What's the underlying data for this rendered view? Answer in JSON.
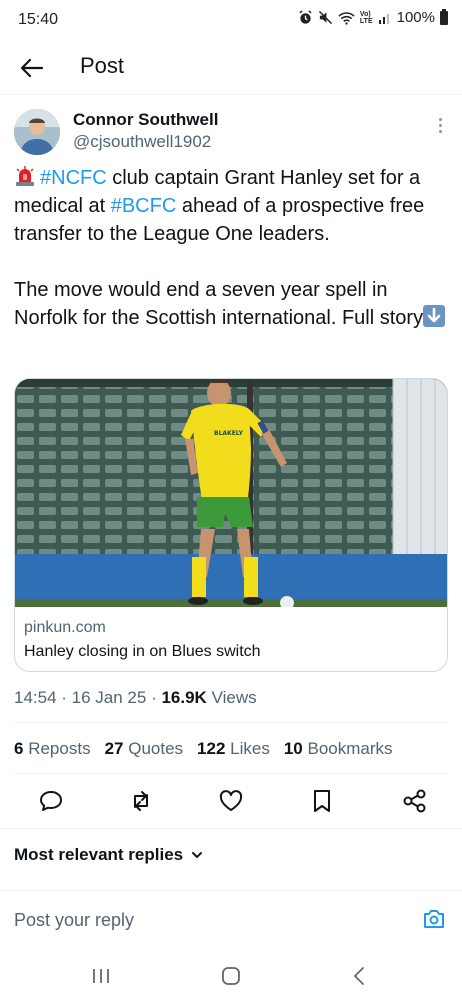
{
  "status_bar": {
    "time": "15:40",
    "battery": "100%",
    "net_label_top": "Vo)",
    "net_label_bottom": "LTE"
  },
  "header": {
    "title": "Post",
    "back_icon": "arrow-left-icon"
  },
  "author": {
    "name": "Connor Southwell",
    "handle": "@cjsouthwell1902"
  },
  "tweet": {
    "p1_a": "club captain Grant Hanley set for a medical at",
    "p1_b": "ahead of a prospective free transfer to the League One leaders.",
    "hashtag1": "#NCFC",
    "hashtag2": "#BCFC",
    "p2": "The move would end a seven year spell in Norfolk for the Scottish international. Full story",
    "link_color": "#1d9bf0"
  },
  "card": {
    "domain": "pinkun.com",
    "title": "Hanley closing in on Blues switch",
    "shirt_sponsor": "BLAKELY"
  },
  "meta": {
    "time": "14:54",
    "date": "16 Jan 25",
    "views_count": "16.9K",
    "views_label": "Views"
  },
  "stats": {
    "reposts_count": "6",
    "reposts_label": "Reposts",
    "quotes_count": "27",
    "quotes_label": "Quotes",
    "likes_count": "122",
    "likes_label": "Likes",
    "bookmarks_count": "10",
    "bookmarks_label": "Bookmarks"
  },
  "replies": {
    "sort_label": "Most relevant replies"
  },
  "reply_bar": {
    "placeholder": "Post your reply"
  }
}
